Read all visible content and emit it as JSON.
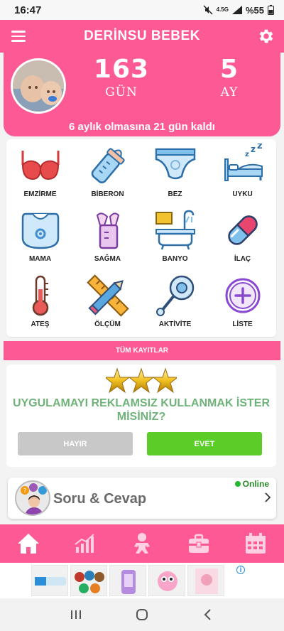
{
  "status_bar": {
    "time": "16:47",
    "network": "4.5G",
    "battery": "%55"
  },
  "header": {
    "title": "DERİNSU BEBEK",
    "menu_icon": "hamburger-icon",
    "settings_icon": "gear-icon"
  },
  "hero": {
    "days_value": "163",
    "days_unit": "GÜN",
    "months_value": "5",
    "months_unit": "AY",
    "countdown": "6 aylık olmasına 21 gün kaldı"
  },
  "actions": [
    {
      "label": "EMZİRME",
      "icon": "bra-icon"
    },
    {
      "label": "BİBERON",
      "icon": "baby-bottle-icon"
    },
    {
      "label": "BEZ",
      "icon": "diaper-icon"
    },
    {
      "label": "UYKU",
      "icon": "sleep-bed-icon"
    },
    {
      "label": "MAMA",
      "icon": "bib-icon"
    },
    {
      "label": "SAĞMA",
      "icon": "breast-pump-icon"
    },
    {
      "label": "BANYO",
      "icon": "bathtub-icon"
    },
    {
      "label": "İLAÇ",
      "icon": "pill-icon"
    },
    {
      "label": "ATEŞ",
      "icon": "thermometer-icon"
    },
    {
      "label": "ÖLÇÜM",
      "icon": "ruler-pencil-icon"
    },
    {
      "label": "AKTİVİTE",
      "icon": "rattle-icon"
    },
    {
      "label": "LİSTE",
      "icon": "plus-circle-icon"
    }
  ],
  "records_bar": {
    "label": "TÜM KAYITLAR"
  },
  "promo": {
    "question": "UYGULAMAYI REKLAMSIZ KULLANMAK İSTER MİSİNİZ?",
    "no_label": "HAYIR",
    "yes_label": "EVET",
    "star_count": 3
  },
  "qa": {
    "title": "Soru & Cevap",
    "status": "Online"
  },
  "bottom_nav": [
    {
      "icon": "home-icon"
    },
    {
      "icon": "chart-icon"
    },
    {
      "icon": "baby-icon"
    },
    {
      "icon": "bag-icon"
    },
    {
      "icon": "calendar-icon"
    }
  ],
  "colors": {
    "primary": "#fd5a95",
    "green": "#5bcc28",
    "promo_text": "#6fb37a",
    "gray_button": "#c8c8c8"
  }
}
